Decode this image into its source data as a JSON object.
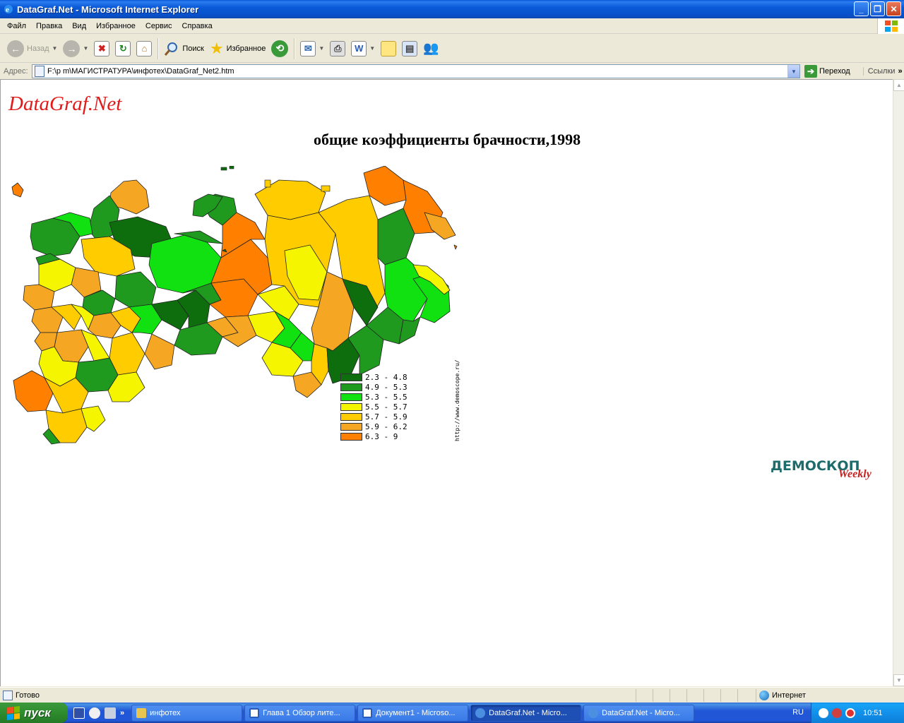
{
  "window": {
    "title": "DataGraf.Net - Microsoft Internet Explorer",
    "minimize": "_",
    "maximize": "❐",
    "close": "✕"
  },
  "menu": {
    "items": [
      "Файл",
      "Правка",
      "Вид",
      "Избранное",
      "Сервис",
      "Справка"
    ]
  },
  "toolbar": {
    "back_label": "Назад",
    "search_label": "Поиск",
    "favorites_label": "Избранное"
  },
  "address": {
    "label": "Адрес:",
    "value": "F:\\p m\\МАГИСТРАТУРА\\инфотех\\DataGraf_Net2.htm",
    "go_label": "Переход",
    "links_label": "Ссылки",
    "links_chevron": "»"
  },
  "page": {
    "logo": "DataGraf.Net",
    "title": "общие коэффициенты брачности,1998",
    "map_url": "http://www.demoscope.ru/",
    "badge_main": "ДЕМОСКОП",
    "badge_sub": "Weekly"
  },
  "chart_data": {
    "type": "choropleth",
    "title": "общие коэффициенты брачности,1998",
    "legend": [
      {
        "label": "2.3 - 4.8",
        "color": "#0e6e0e"
      },
      {
        "label": "4.9 - 5.3",
        "color": "#1f9a1f"
      },
      {
        "label": "5.3 - 5.5",
        "color": "#11e011"
      },
      {
        "label": "5.5 - 5.7",
        "color": "#f5f500"
      },
      {
        "label": "5.7 - 5.9",
        "color": "#ffcc00"
      },
      {
        "label": "5.9 - 6.2",
        "color": "#f5a623"
      },
      {
        "label": "6.3 - 9",
        "color": "#ff8000"
      }
    ]
  },
  "status": {
    "text": "Готово",
    "zone": "Интернет"
  },
  "taskbar": {
    "start_label": "пуск",
    "ql_chevron": "»",
    "tasks": [
      {
        "label": "инфотех",
        "color": "#e8c450"
      },
      {
        "label": "Глава 1 Обзор лите...",
        "color": "#2b5bb8"
      },
      {
        "label": "Документ1 - Microso...",
        "color": "#2b5bb8"
      },
      {
        "label": "DataGraf.Net - Micro...",
        "color": "#4a8fe0"
      },
      {
        "label": "DataGraf.Net - Micro...",
        "color": "#4a8fe0"
      }
    ],
    "lang": "RU",
    "clock": "10:51"
  }
}
